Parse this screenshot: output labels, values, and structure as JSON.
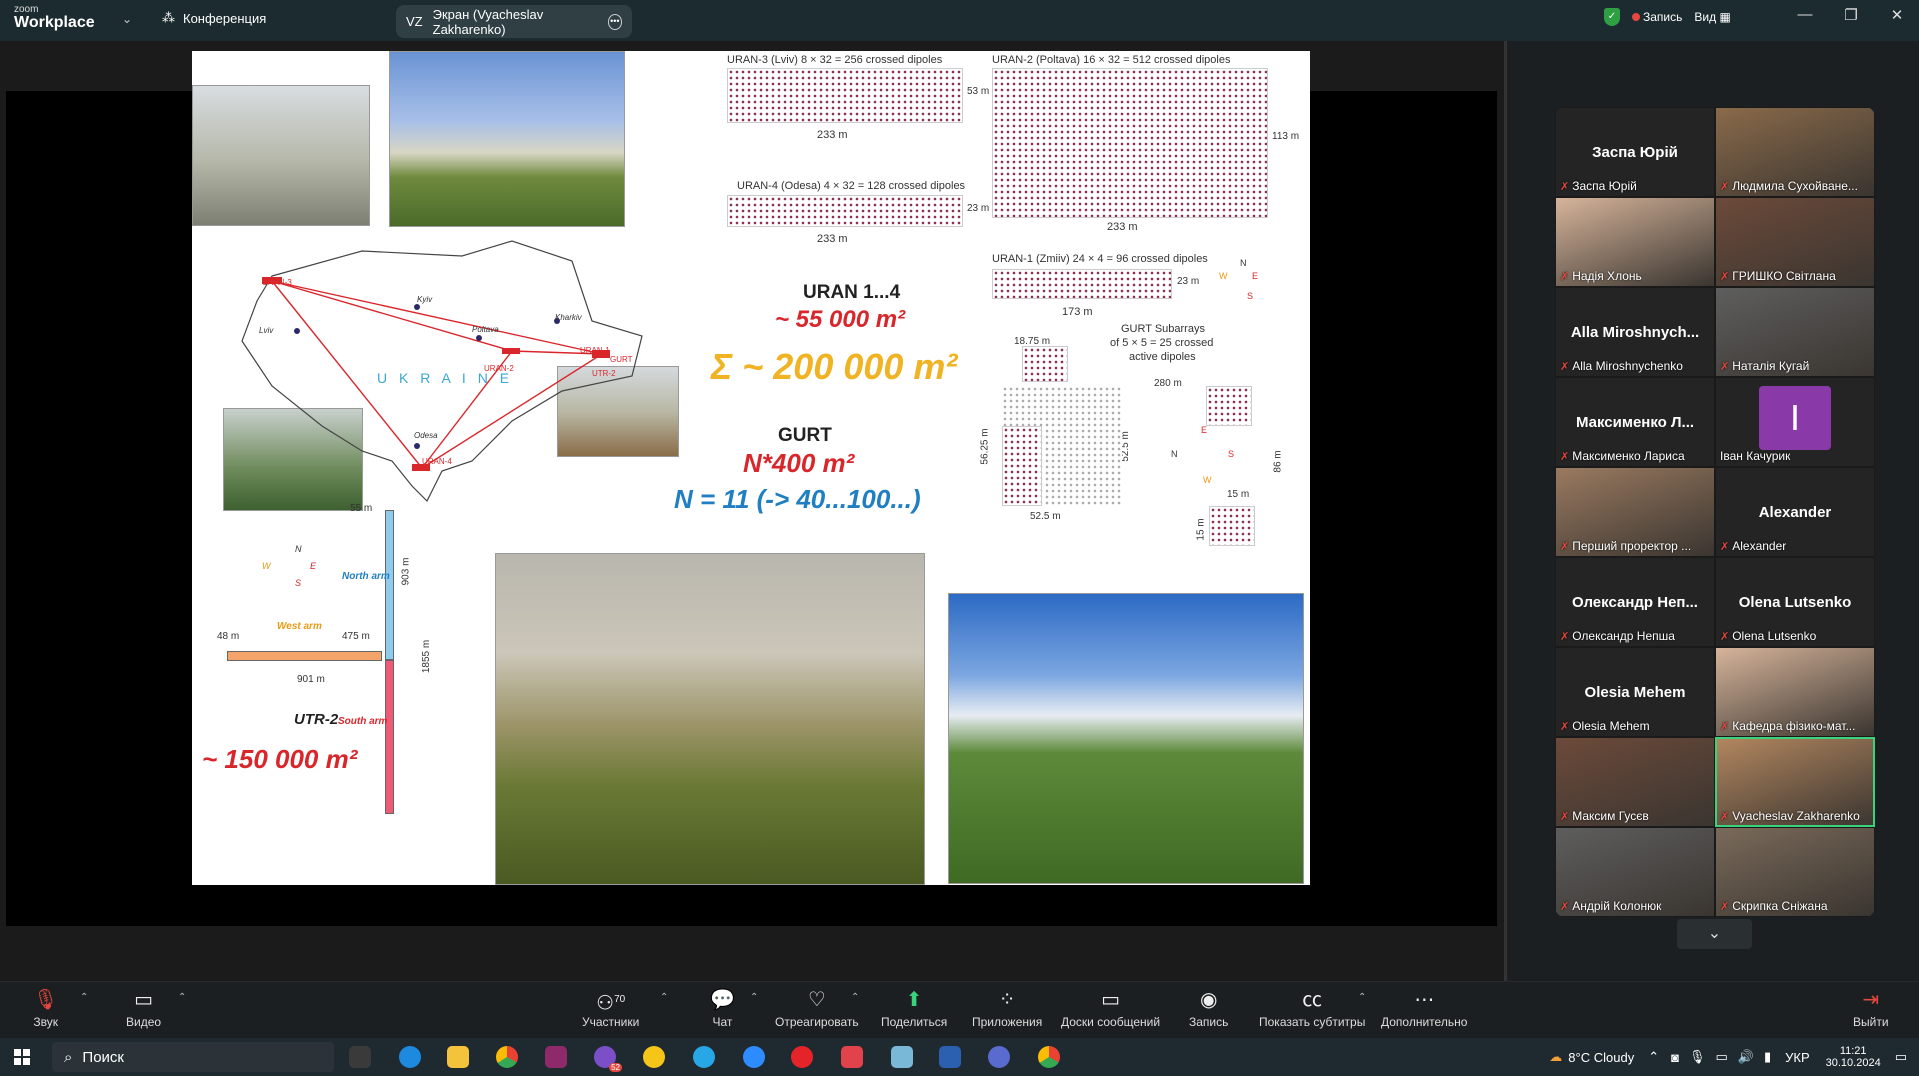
{
  "titlebar": {
    "brand_small": "zoom",
    "brand_main": "Workplace",
    "meeting_label": "Конференция",
    "share_initials": "VZ",
    "share_label": "Экран (Vyacheslav Zakharenko)",
    "record_label": "Запись",
    "view_label": "Вид"
  },
  "slide": {
    "uran3_title": "URAN-3 (Lviv) 8 × 32 = 256 crossed dipoles",
    "uran3_w": "233 m",
    "uran3_h": "53 m",
    "uran2_title": "URAN-2 (Poltava) 16 × 32 = 512 crossed dipoles",
    "uran2_w": "233 m",
    "uran2_h": "113 m",
    "uran4_title": "URAN-4 (Odesa) 4 × 32 = 128 crossed dipoles",
    "uran4_w": "233 m",
    "uran4_h": "23 m",
    "uran1_title": "URAN-1 (Zmiiv) 24 × 4 = 96 crossed dipoles",
    "uran1_w": "173 m",
    "uran1_h": "23 m",
    "uran_heading": "URAN 1...4",
    "uran_area": "~ 55 000 m²",
    "sum_area": "Σ ~ 200 000 m²",
    "gurt_heading": "GURT",
    "gurt_area": "N*400 m²",
    "gurt_n": "N = 11 (-> 40...100...)",
    "gurt_sub_title": "GURT Subarrays",
    "gurt_sub_line2": "of 5 × 5 = 25 crossed",
    "gurt_sub_line3": "active dipoles",
    "gurt_1875": "18.75 m",
    "gurt_280": "280 m",
    "gurt_5625": "56.25 m",
    "gurt_525v": "52.5 m",
    "gurt_525h": "52.5 m",
    "gurt_86": "86 m",
    "gurt_15a": "15 m",
    "gurt_15b": "15 m",
    "ukraine": "U K R A I N E",
    "map_uran3": "URAN-3",
    "map_lviv": "Lviv",
    "map_kyiv": "Kyiv",
    "map_kharkiv": "Kharkiv",
    "map_poltava": "Poltava",
    "map_odesa": "Odesa",
    "map_uran4": "URAN-4",
    "map_uran1": "URAN-1",
    "map_uran2": "URAN-2",
    "map_gurt": "GURT",
    "map_utr2": "UTR-2",
    "utr_55": "55 m",
    "utr_903": "903 m",
    "utr_1855": "1855 m",
    "utr_north": "North arm",
    "utr_west": "West arm",
    "utr_south": "South arm",
    "utr_48": "48 m",
    "utr_475": "475 m",
    "utr_901": "901 m",
    "utr_label": "UTR-2",
    "utr_area": "~ 150 000 m²",
    "compass_n": "N",
    "compass_s": "S",
    "compass_e": "E",
    "compass_w": "W"
  },
  "participants": [
    {
      "big": "Заспа Юрій",
      "name": "Заспа Юрій",
      "video": false
    },
    {
      "big": "",
      "name": "Людмила Сухойване...",
      "video": true
    },
    {
      "big": "",
      "name": "Надія Хлонь",
      "video": true
    },
    {
      "big": "",
      "name": "ГРИШКО Світлана",
      "video": true
    },
    {
      "big": "Alla Miroshnych...",
      "name": "Alla Miroshnychenko",
      "video": false
    },
    {
      "big": "",
      "name": "Наталія Кугай",
      "video": true
    },
    {
      "big": "Максименко Л...",
      "name": "Максименко Лариса",
      "video": false
    },
    {
      "big": "I",
      "name": "Іван Качурик",
      "video": false,
      "purple": true
    },
    {
      "big": "",
      "name": "Перший проректор ...",
      "video": true
    },
    {
      "big": "Alexander",
      "name": "Alexander",
      "video": false
    },
    {
      "big": "Олександр Неп...",
      "name": "Олександр Непша",
      "video": false
    },
    {
      "big": "Olena Lutsenko",
      "name": "Olena Lutsenko",
      "video": false
    },
    {
      "big": "Olesia Mehem",
      "name": "Olesia Mehem",
      "video": false
    },
    {
      "big": "",
      "name": "Кафедра фізико-мат...",
      "video": true
    },
    {
      "big": "",
      "name": "Максим Гусєв",
      "video": true
    },
    {
      "big": "",
      "name": "Vyacheslav Zakharenko",
      "video": true,
      "active": true
    },
    {
      "big": "",
      "name": "Андрій Колонюк",
      "video": true
    },
    {
      "big": "",
      "name": "Скрипка Сніжана",
      "video": true
    }
  ],
  "toolbar": {
    "audio": "Звук",
    "video": "Видео",
    "participants": "Участники",
    "participants_count": "70",
    "chat": "Чат",
    "react": "Отреагировать",
    "share": "Поделиться",
    "apps": "Приложения",
    "whiteboards": "Доски сообщений",
    "record": "Запись",
    "captions": "Показать субтитры",
    "more": "Дополнительно",
    "leave": "Выйти"
  },
  "taskbar": {
    "search": "Поиск",
    "weather": "8°C  Cloudy",
    "lang": "УКР",
    "time": "11:21",
    "date": "30.10.2024",
    "badge_count": "52"
  },
  "colors": {
    "accent_green": "#3ad27a",
    "record_red": "#e5483e",
    "slide_red": "#d9262b",
    "slide_orange": "#f0b323",
    "slide_blue": "#1f7fc2"
  }
}
